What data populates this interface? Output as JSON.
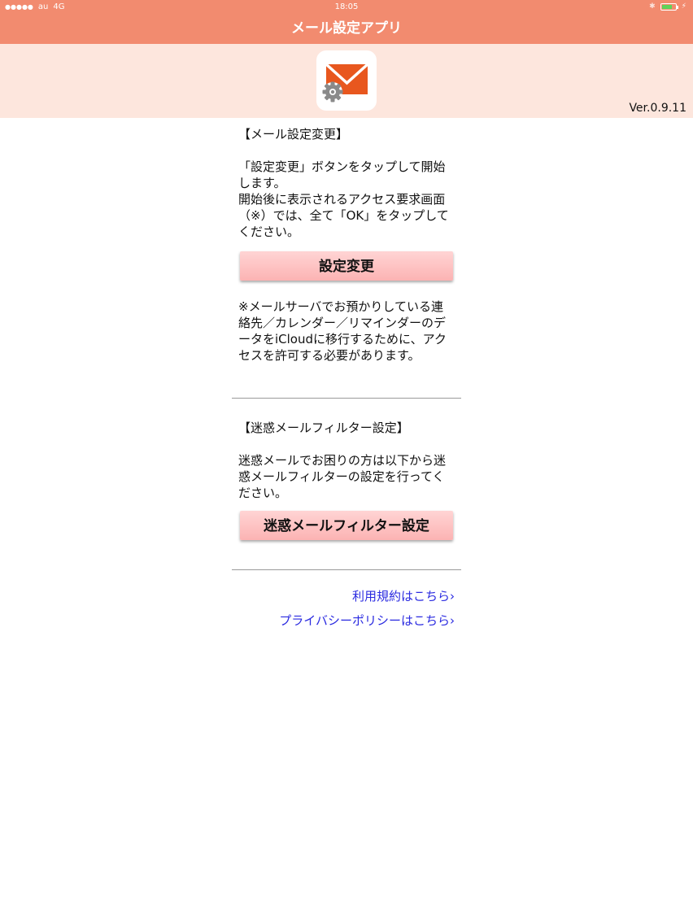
{
  "status_bar": {
    "signal_dots": "●●●●●",
    "carrier": "au",
    "network": "4G",
    "time": "18:05",
    "bluetooth_icon": "bluetooth-icon",
    "battery_icon": "battery-charging-icon"
  },
  "app": {
    "title": "メール設定アプリ",
    "icon": "mail-gear-icon",
    "version": "Ver.0.9.11"
  },
  "mail_settings": {
    "heading": "【メール設定変更】",
    "description_1": "「設定変更」ボタンをタップして開始します。",
    "description_2": "開始後に表示されるアクセス要求画面（※）では、全て「OK」をタップしてください。",
    "button_label": "設定変更",
    "note": "※メールサーバでお預かりしている連絡先／カレンダー／リマインダーのデータをiCloudに移行するために、アクセスを許可する必要があります。"
  },
  "spam_filter": {
    "heading": "【迷惑メールフィルター設定】",
    "description": "迷惑メールでお困りの方は以下から迷惑メールフィルターの設定を行ってください。",
    "button_label": "迷惑メールフィルター設定"
  },
  "links": {
    "terms": "利用規約はこちら",
    "privacy": "プライバシーポリシーはこちら",
    "chevron_icon": "chevron-right-icon"
  },
  "colors": {
    "accent": "#f28b6f",
    "header_band": "#fde6dd",
    "button": "#fcb3b3",
    "link": "#2a2ae0",
    "icon_orange": "#e8571e"
  }
}
